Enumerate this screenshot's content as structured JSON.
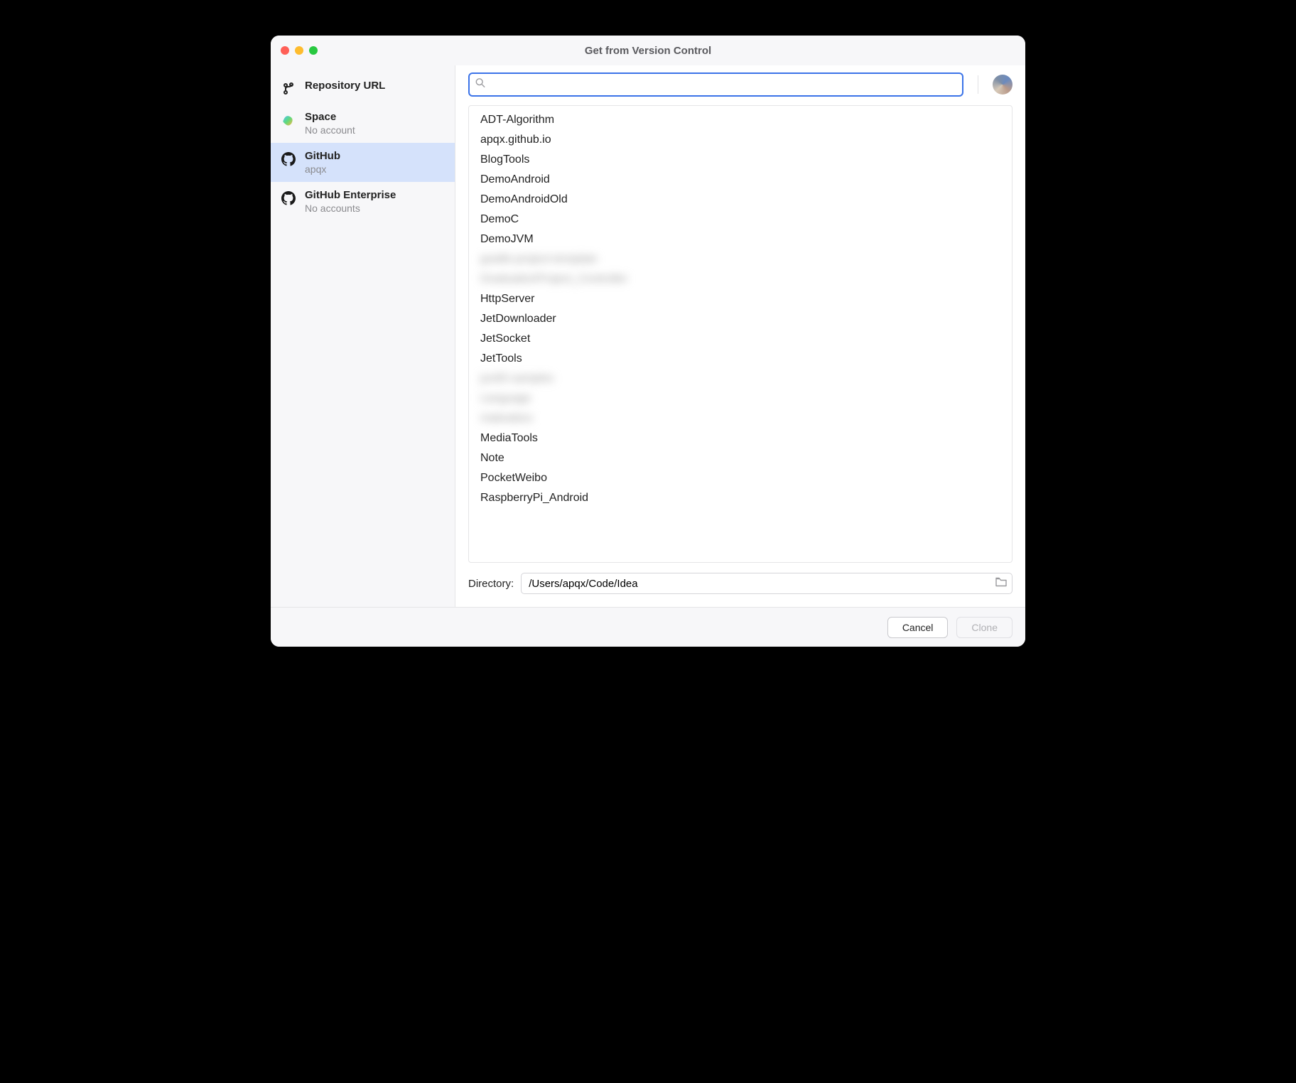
{
  "window": {
    "title": "Get from Version Control"
  },
  "sidebar": {
    "items": [
      {
        "label": "Repository URL",
        "sub": ""
      },
      {
        "label": "Space",
        "sub": "No account"
      },
      {
        "label": "GitHub",
        "sub": "apqx"
      },
      {
        "label": "GitHub Enterprise",
        "sub": "No accounts"
      }
    ]
  },
  "search": {
    "value": "",
    "placeholder": ""
  },
  "repos": [
    {
      "name": "ADT-Algorithm",
      "blurred": false
    },
    {
      "name": "apqx.github.io",
      "blurred": false
    },
    {
      "name": "BlogTools",
      "blurred": false
    },
    {
      "name": "DemoAndroid",
      "blurred": false
    },
    {
      "name": "DemoAndroidOld",
      "blurred": false
    },
    {
      "name": "DemoC",
      "blurred": false
    },
    {
      "name": "DemoJVM",
      "blurred": false
    },
    {
      "name": "gradle-project-template",
      "blurred": true
    },
    {
      "name": "GraduationProject_Controller",
      "blurred": true
    },
    {
      "name": "HttpServer",
      "blurred": false
    },
    {
      "name": "JetDownloader",
      "blurred": false
    },
    {
      "name": "JetSocket",
      "blurred": false
    },
    {
      "name": "JetTools",
      "blurred": false
    },
    {
      "name": "junit5-samples",
      "blurred": true
    },
    {
      "name": "Language",
      "blurred": true
    },
    {
      "name": "makeabox",
      "blurred": true
    },
    {
      "name": "MediaTools",
      "blurred": false
    },
    {
      "name": "Note",
      "blurred": false
    },
    {
      "name": "PocketWeibo",
      "blurred": false
    },
    {
      "name": "RaspberryPi_Android",
      "blurred": false
    }
  ],
  "directory": {
    "label": "Directory:",
    "value": "/Users/apqx/Code/Idea"
  },
  "buttons": {
    "cancel": "Cancel",
    "clone": "Clone"
  }
}
